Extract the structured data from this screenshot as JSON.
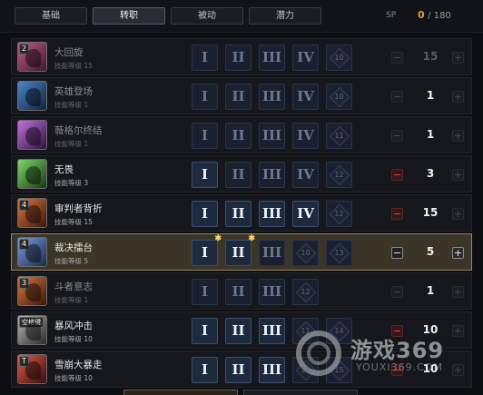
{
  "tabs": [
    {
      "label": "基础"
    },
    {
      "label": "转职"
    },
    {
      "label": "被动"
    },
    {
      "label": "潜力"
    }
  ],
  "sp": {
    "label": "SP",
    "current": "0",
    "total": "/ 180"
  },
  "skills": [
    {
      "name": "大回旋",
      "level": "技能等级 15",
      "badge": "2",
      "points": "15",
      "runes": [
        "I",
        "II",
        "III",
        "IV",
        "10"
      ],
      "color": "#8a3a6a",
      "icon": "spin-attack-icon"
    },
    {
      "name": "英雄登场",
      "level": "技能等级 1",
      "points": "1",
      "runes": [
        "I",
        "II",
        "III",
        "IV",
        "10"
      ],
      "color": "#2a4f8a",
      "icon": "hero-entrance-icon"
    },
    {
      "name": "薇格尔终结",
      "level": "技能等级 1",
      "points": "1",
      "runes": [
        "I",
        "II",
        "III",
        "IV",
        "11"
      ],
      "color": "#7a3a9a",
      "icon": "finisher-icon"
    },
    {
      "name": "无畏",
      "level": "技能等级 3",
      "points": "3",
      "runes": [
        "I",
        "II",
        "III",
        "IV",
        "12"
      ],
      "color": "#3e8a3a",
      "icon": "fearless-icon"
    },
    {
      "name": "审判者背折",
      "level": "技能等级 15",
      "badge": "4",
      "points": "15",
      "runes": [
        "I",
        "II",
        "III",
        "IV",
        "12"
      ],
      "color": "#a04a26",
      "icon": "judge-backbreak-icon"
    },
    {
      "name": "裁决擂台",
      "level": "技能等级 5",
      "badge": "4",
      "points": "5",
      "runes": [
        "I",
        "II",
        "III",
        "10",
        "13"
      ],
      "color": "#3a5a9a",
      "icon": "judgment-arena-icon"
    },
    {
      "name": "斗者意志",
      "level": "技能等级 1",
      "badge": "3",
      "points": "1",
      "runes": [
        "I",
        "II",
        "III",
        "12"
      ],
      "color": "#a04a26",
      "icon": "fighter-will-icon"
    },
    {
      "name": "暴风冲击",
      "level": "技能等级 10",
      "badge": "空格键",
      "points": "10",
      "runes": [
        "I",
        "II",
        "III",
        "11",
        "14"
      ],
      "color": "#6a6a6a",
      "icon": "storm-impact-icon"
    },
    {
      "name": "雪崩大暴走",
      "level": "技能等级 10",
      "badge": "T",
      "points": "10",
      "runes": [
        "I",
        "II",
        "III",
        "12",
        "15"
      ],
      "color": "#a02a2a",
      "icon": "avalanche-rampage-icon"
    }
  ],
  "watermark": {
    "main": "游戏369",
    "sub": "YOUXI369.COM"
  }
}
